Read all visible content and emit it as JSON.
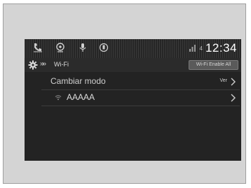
{
  "status_bar": {
    "icons": [
      "call-icon",
      "navigation-icon",
      "microphone-icon",
      "phone-icon"
    ],
    "signal_indicator": "4",
    "clock": "12:34"
  },
  "header": {
    "icon": "gear-icon",
    "breadcrumb_arrows": "»»",
    "title": "Wi-Fi",
    "button_label": "Wi-Fi Enable All"
  },
  "list": {
    "rows": [
      {
        "label": "Cambiar modo",
        "value": "Ver",
        "icon": "chevron-right-icon"
      },
      {
        "label": "AAAAA",
        "icon": "wifi-icon"
      }
    ]
  },
  "colors": {
    "screen_bg": "#232323",
    "frame_bg": "#d4d4d4",
    "text": "#cfcfcf"
  }
}
